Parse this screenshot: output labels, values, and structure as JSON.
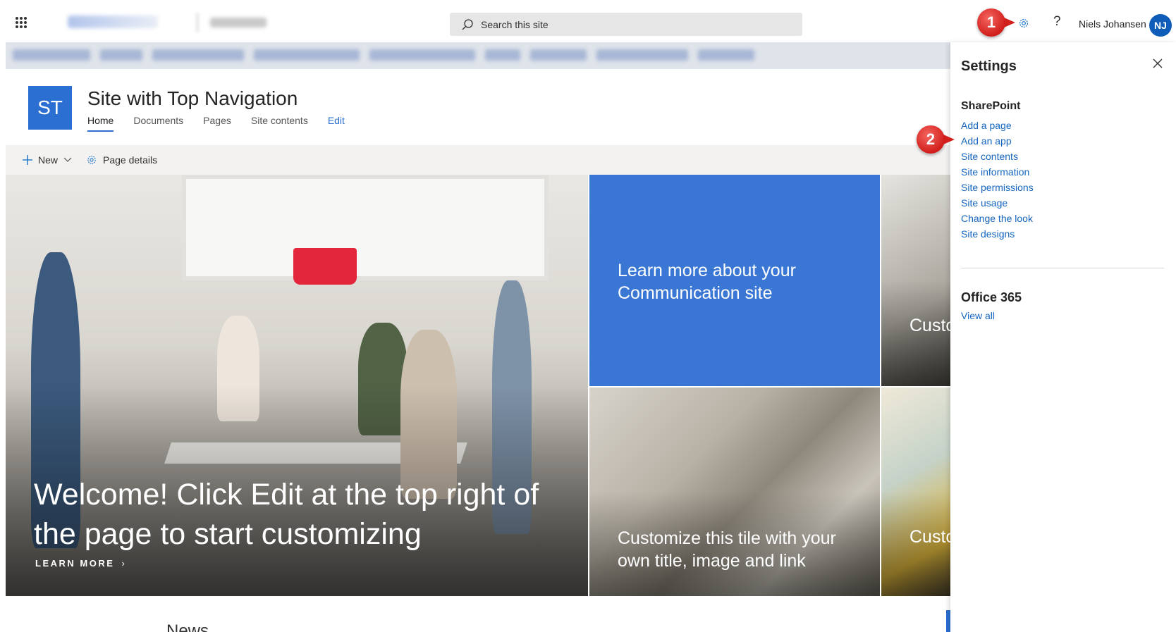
{
  "suite_bar": {
    "search_placeholder": "Search this site",
    "user_name": "Niels Johansen",
    "user_initials": "NJ"
  },
  "callouts": {
    "first": "1",
    "second": "2"
  },
  "site": {
    "logo_initials": "ST",
    "title": "Site with Top Navigation",
    "nav": [
      {
        "label": "Home",
        "active": true
      },
      {
        "label": "Documents"
      },
      {
        "label": "Pages"
      },
      {
        "label": "Site contents"
      },
      {
        "label": "Edit"
      }
    ]
  },
  "command_bar": {
    "new_label": "New",
    "page_details_label": "Page details"
  },
  "hero": {
    "title": "Welcome! Click Edit at the top right of the page to start customizing",
    "learn_more": "LEARN MORE",
    "tile_blue": "Learn more about your Communication site",
    "tile_image": "Customize this tile with your own title, image and link",
    "tile_side_top": "Customize this tile with your own title",
    "tile_side_bottom": "Customize this tile with your own title"
  },
  "news_heading": "News",
  "settings_panel": {
    "title": "Settings",
    "sharepoint_heading": "SharePoint",
    "links": [
      "Add a page",
      "Add an app",
      "Site contents",
      "Site information",
      "Site permissions",
      "Site usage",
      "Change the look",
      "Site designs"
    ],
    "office365_heading": "Office 365",
    "view_all": "View all"
  },
  "colors": {
    "accent": "#2a6fd1",
    "link": "#1565c0",
    "callout": "#d11f1b"
  }
}
